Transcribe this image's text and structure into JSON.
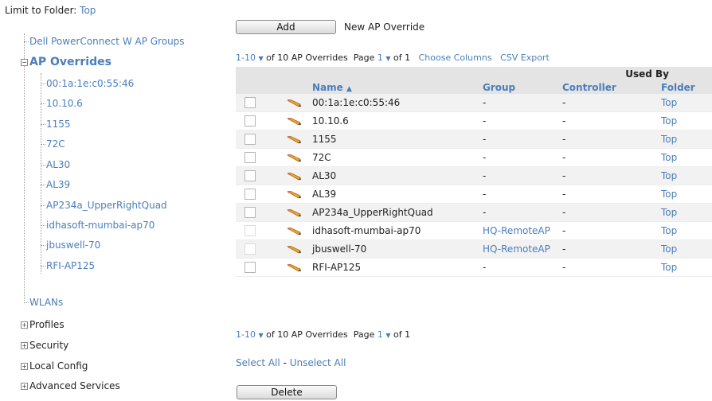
{
  "limit": {
    "label": "Limit to Folder:",
    "folder": "Top"
  },
  "tree": {
    "groups": "Dell PowerConnect W AP Groups",
    "overrides_label": "AP Overrides",
    "override_items": [
      "00:1a:1e:c0:55:46",
      "10.10.6",
      "1155",
      "72C",
      "AL30",
      "AL39",
      "AP234a_UpperRightQuad",
      "idhasoft-mumbai-ap70",
      "jbuswell-70",
      "RFI-AP125"
    ],
    "wlans": "WLANs",
    "profiles": "Profiles",
    "security": "Security",
    "local_config": "Local Config",
    "advanced_services": "Advanced Services"
  },
  "toolbar": {
    "add_label": "Add",
    "new_label": "New AP Override"
  },
  "pager_top": {
    "range": "1-10",
    "of_text": "of 10 AP Overrides",
    "page_label": "Page",
    "page": "1",
    "of_pages": "of 1",
    "choose_columns": "Choose Columns",
    "csv_export": "CSV Export"
  },
  "table": {
    "used_by": "Used By",
    "columns": {
      "name": "Name",
      "group": "Group",
      "controller": "Controller",
      "folder": "Folder"
    },
    "rows": [
      {
        "name": "00:1a:1e:c0:55:46",
        "group": "-",
        "controller": "-",
        "folder": "Top"
      },
      {
        "name": "10.10.6",
        "group": "-",
        "controller": "-",
        "folder": "Top"
      },
      {
        "name": "1155",
        "group": "-",
        "controller": "-",
        "folder": "Top"
      },
      {
        "name": "72C",
        "group": "-",
        "controller": "-",
        "folder": "Top"
      },
      {
        "name": "AL30",
        "group": "-",
        "controller": "-",
        "folder": "Top"
      },
      {
        "name": "AL39",
        "group": "-",
        "controller": "-",
        "folder": "Top"
      },
      {
        "name": "AP234a_UpperRightQuad",
        "group": "-",
        "controller": "-",
        "folder": "Top"
      },
      {
        "name": "idhasoft-mumbai-ap70",
        "group": "HQ-RemoteAP",
        "controller": "-",
        "folder": "Top"
      },
      {
        "name": "jbuswell-70",
        "group": "HQ-RemoteAP",
        "controller": "-",
        "folder": "Top"
      },
      {
        "name": "RFI-AP125",
        "group": "-",
        "controller": "-",
        "folder": "Top"
      }
    ]
  },
  "pager_bottom": {
    "range": "1-10",
    "of_text": "of 10 AP Overrides",
    "page_label": "Page",
    "page": "1",
    "of_pages": "of 1"
  },
  "select": {
    "all": "Select All",
    "sep": " - ",
    "none": "Unselect All"
  },
  "delete_label": "Delete",
  "colors": {
    "link": "#4a7ebb",
    "header_bg": "#e4e4e4",
    "alt_row": "#f2f2f2"
  },
  "icons": {
    "row_edit": "pencil-icon",
    "expand": "plus-box-icon",
    "collapse": "minus-box-icon"
  }
}
